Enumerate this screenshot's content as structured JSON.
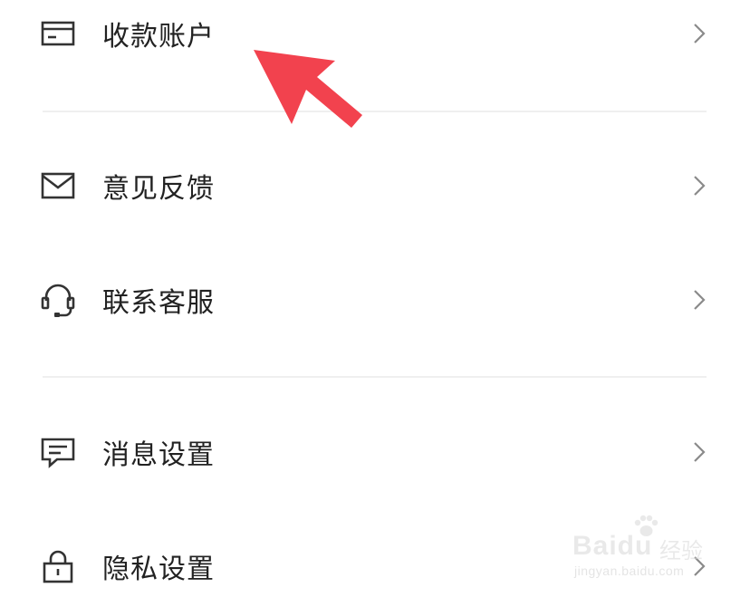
{
  "menu": {
    "items": [
      {
        "label": "收款账户",
        "icon": "bank-card-icon"
      },
      {
        "label": "意见反馈",
        "icon": "envelope-icon"
      },
      {
        "label": "联系客服",
        "icon": "headset-icon"
      },
      {
        "label": "消息设置",
        "icon": "message-icon"
      },
      {
        "label": "隐私设置",
        "icon": "lock-icon"
      }
    ]
  },
  "annotation": {
    "color": "#f2424e",
    "icon": "red-arrow-pointer"
  },
  "watermark": {
    "brand": "Baidu",
    "product": "经验",
    "url": "jingyan.baidu.com"
  },
  "colors": {
    "text": "#222222",
    "icon": "#333333",
    "chevron": "#8a8a8a",
    "divider": "#efefef"
  }
}
